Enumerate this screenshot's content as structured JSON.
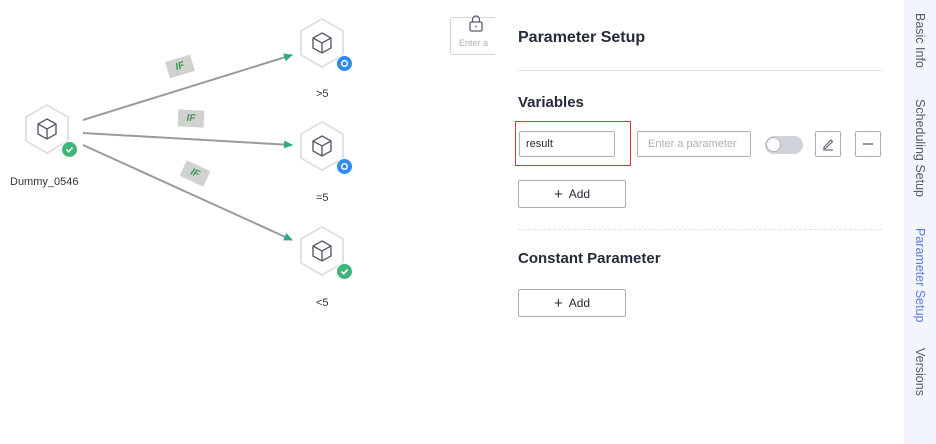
{
  "canvas": {
    "source_node": {
      "label": "Dummy_0546",
      "status": "success"
    },
    "targets": [
      {
        "label": ">5",
        "status": "running"
      },
      {
        "label": "=5",
        "status": "running"
      },
      {
        "label": "<5",
        "status": "success"
      }
    ],
    "edge_labels": [
      "IF",
      "IF",
      "IF"
    ],
    "search_placeholder": "Enter a",
    "lock_icon": "lock-icon"
  },
  "panel": {
    "title": "Parameter Setup",
    "variables": {
      "title": "Variables",
      "rows": [
        {
          "name": "result",
          "value_placeholder": "Enter a parameter",
          "enabled": false
        }
      ],
      "add_label": "Add"
    },
    "constants": {
      "title": "Constant Parameter",
      "add_label": "Add"
    }
  },
  "side_tabs": [
    {
      "label": "Basic Info",
      "active": false
    },
    {
      "label": "Scheduling Setup",
      "active": false
    },
    {
      "label": "Parameter Setup",
      "active": true
    },
    {
      "label": "Versions",
      "active": false
    }
  ],
  "colors": {
    "edge": "#9a9a9a",
    "arrow": "#30a88d",
    "success": "#3fb577",
    "running": "#2f8cf5",
    "active_tab": "#5e7ce0",
    "highlight": "#d9343b"
  }
}
